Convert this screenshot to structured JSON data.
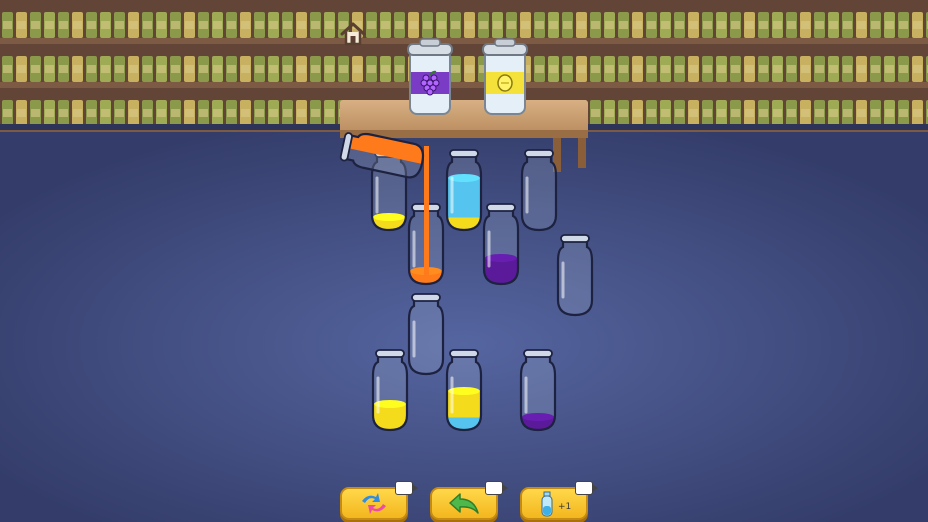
{
  "level": {
    "bottle_capacity": 4,
    "bottles": [
      {
        "layers": [
          "yellow"
        ],
        "state": "idle"
      },
      {
        "layers": [
          "yellow",
          "blue",
          "blue",
          "blue"
        ],
        "state": "idle"
      },
      {
        "layers": [],
        "state": "idle"
      },
      {
        "layers": [
          "orange"
        ],
        "state": "receiving"
      },
      {
        "layers": [
          "purple",
          "purple"
        ],
        "state": "idle"
      },
      {
        "layers": [],
        "state": "idle"
      },
      {
        "layers": [],
        "state": "idle"
      },
      {
        "layers": [
          "yellow",
          "yellow"
        ],
        "state": "idle"
      },
      {
        "layers": [
          "blue",
          "yellow",
          "yellow"
        ],
        "state": "idle"
      },
      {
        "layers": [
          "purple"
        ],
        "state": "idle"
      }
    ],
    "pouring_bottle": {
      "liquid": "orange",
      "target_index": 3
    }
  },
  "colors": {
    "yellow": "#f4dc1c",
    "blue": "#55c4ee",
    "purple": "#5a1a9a",
    "orange": "#ff7a1a",
    "table": "#c49a6c",
    "floor": "#3d4778",
    "wall": "#6a4a3a",
    "button": "#f8c72c"
  },
  "shelf_cups": [
    {
      "icon": "grapes-icon",
      "band_color": "#7a3cc4"
    },
    {
      "icon": "lemon-icon",
      "band_color": "#f4e23a"
    }
  ],
  "toolbar": [
    {
      "name": "shuffle-button",
      "icon": "shuffle-icon"
    },
    {
      "name": "undo-button",
      "icon": "undo-arrow-icon"
    },
    {
      "name": "add-bottle-button",
      "icon": "add-bottle-icon"
    }
  ]
}
